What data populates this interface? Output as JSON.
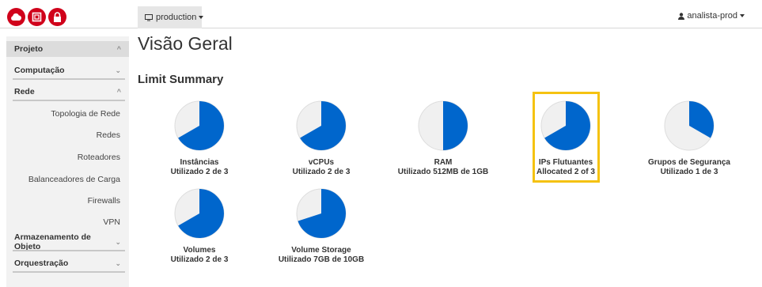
{
  "topbar": {
    "project_label": "production",
    "user_label": "analista-prod"
  },
  "sidebar": {
    "projeto": "Projeto",
    "computacao": "Computação",
    "rede": "Rede",
    "rede_items": [
      "Topologia de Rede",
      "Redes",
      "Roteadores",
      "Balanceadores de Carga",
      "Firewalls",
      "VPN"
    ],
    "armazenamento": "Armazenamento de Objeto",
    "orquestracao": "Orquestração"
  },
  "main": {
    "title": "Visão Geral",
    "section": "Limit Summary"
  },
  "colors": {
    "used": "#0066cc",
    "free": "#f0f0f0",
    "highlight": "#f5c211"
  },
  "chart_data": {
    "type": "pie",
    "charts": [
      {
        "name": "Instâncias",
        "usage": "Utilizado 2 de 3",
        "used": 2,
        "total": 3
      },
      {
        "name": "vCPUs",
        "usage": "Utilizado 2 de 3",
        "used": 2,
        "total": 3
      },
      {
        "name": "RAM",
        "usage": "Utilizado 512MB de 1GB",
        "used": 512,
        "total": 1024
      },
      {
        "name": "IPs Flutuantes",
        "usage": "Allocated 2 of 3",
        "used": 2,
        "total": 3
      },
      {
        "name": "Grupos de Segurança",
        "usage": "Utilizado 1 de 3",
        "used": 1,
        "total": 3
      },
      {
        "name": "Volumes",
        "usage": "Utilizado 2 de 3",
        "used": 2,
        "total": 3
      },
      {
        "name": "Volume Storage",
        "usage": "Utilizado 7GB de 10GB",
        "used": 7,
        "total": 10
      }
    ]
  }
}
